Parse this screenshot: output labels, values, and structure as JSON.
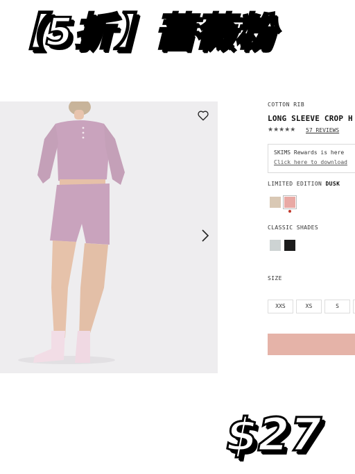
{
  "banner": {
    "text": "【5折】蔷薇粉"
  },
  "price": {
    "text": "$27"
  },
  "product": {
    "collection": "COTTON RIB",
    "title": "LONG SLEEVE CROP H",
    "stars": "★★★★★",
    "rating": 4.5,
    "reviews": "57 REVIEWS"
  },
  "rewards": {
    "line1": "SKIMS Rewards is here",
    "line2": "Click here to download"
  },
  "limited_edition": {
    "label": "LIMITED EDITION",
    "selected": "DUSK",
    "swatches": [
      {
        "name": "sand-swatch",
        "color": "#d9c8b4"
      },
      {
        "name": "dusk-swatch",
        "color": "#e9a9a4"
      }
    ]
  },
  "classic_shades": {
    "label": "CLASSIC SHADES",
    "swatches": [
      {
        "name": "light-gray-swatch",
        "color": "#cdd3d3"
      },
      {
        "name": "black-swatch",
        "color": "#1c1c1c"
      }
    ]
  },
  "size": {
    "label": "SIZE",
    "options": [
      "XXS",
      "XS",
      "S"
    ]
  },
  "colors": {
    "garment": "#c9a3bd",
    "add_button": "#e5b3a8"
  },
  "icons": [
    "heart-icon",
    "chevron-right-icon"
  ]
}
